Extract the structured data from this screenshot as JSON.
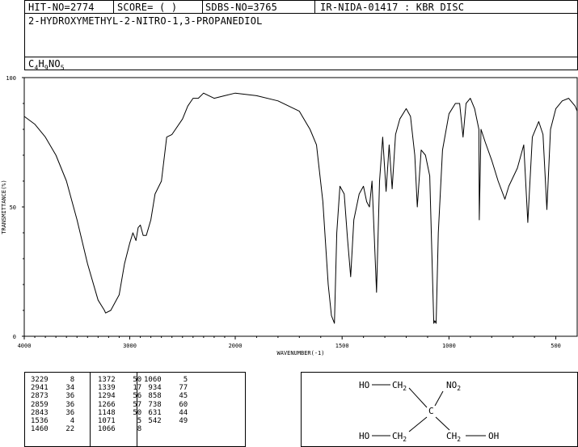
{
  "header": {
    "hit": "HIT-NO=2774",
    "score": "SCORE=  (  )",
    "sdbs": "SDBS-NO=3765",
    "ir": "IR-NIDA-01417 : KBR DISC"
  },
  "compound_name": "2-HYDROXYMETHYL-2-NITRO-1,3-PROPANEDIOL",
  "formula": {
    "c": "C",
    "c_n": "4",
    "h": "H",
    "h_n": "9",
    "rest": "NO",
    "o_n": "5"
  },
  "chart_data": {
    "type": "line",
    "xlabel": "WAVENUMBER(-1)",
    "ylabel": "TRANSMITTANCE(%)",
    "xlim": [
      4000,
      400
    ],
    "ylim": [
      0,
      100
    ],
    "x_ticks": [
      4000,
      3000,
      2000,
      1500,
      1000,
      500
    ],
    "x_tick_labels": [
      "4000",
      "3000",
      "2000",
      "1500",
      "1000",
      "500"
    ],
    "y_ticks": [
      0,
      50,
      100
    ],
    "y_tick_labels": [
      "0",
      "50",
      "100"
    ],
    "series": [
      {
        "points": [
          [
            4000,
            85
          ],
          [
            3900,
            82
          ],
          [
            3800,
            77
          ],
          [
            3700,
            70
          ],
          [
            3600,
            60
          ],
          [
            3500,
            45
          ],
          [
            3400,
            28
          ],
          [
            3300,
            14
          ],
          [
            3240,
            10
          ],
          [
            3229,
            9
          ],
          [
            3180,
            10
          ],
          [
            3100,
            16
          ],
          [
            3050,
            28
          ],
          [
            3000,
            36
          ],
          [
            2970,
            40
          ],
          [
            2941,
            37
          ],
          [
            2920,
            42
          ],
          [
            2900,
            43
          ],
          [
            2873,
            39
          ],
          [
            2859,
            39
          ],
          [
            2843,
            39
          ],
          [
            2800,
            45
          ],
          [
            2760,
            55
          ],
          [
            2700,
            60
          ],
          [
            2650,
            77
          ],
          [
            2600,
            78
          ],
          [
            2500,
            84
          ],
          [
            2450,
            89
          ],
          [
            2400,
            92
          ],
          [
            2350,
            92
          ],
          [
            2300,
            94
          ],
          [
            2200,
            92
          ],
          [
            2100,
            93
          ],
          [
            2000,
            94
          ],
          [
            1900,
            93
          ],
          [
            1800,
            91
          ],
          [
            1700,
            87
          ],
          [
            1650,
            80
          ],
          [
            1620,
            74
          ],
          [
            1590,
            52
          ],
          [
            1565,
            20
          ],
          [
            1550,
            8
          ],
          [
            1536,
            5
          ],
          [
            1525,
            40
          ],
          [
            1510,
            58
          ],
          [
            1490,
            55
          ],
          [
            1475,
            38
          ],
          [
            1460,
            23
          ],
          [
            1445,
            45
          ],
          [
            1420,
            55
          ],
          [
            1400,
            58
          ],
          [
            1385,
            52
          ],
          [
            1372,
            50
          ],
          [
            1360,
            60
          ],
          [
            1350,
            40
          ],
          [
            1339,
            17
          ],
          [
            1325,
            60
          ],
          [
            1310,
            77
          ],
          [
            1294,
            56
          ],
          [
            1280,
            74
          ],
          [
            1266,
            57
          ],
          [
            1250,
            78
          ],
          [
            1230,
            84
          ],
          [
            1200,
            88
          ],
          [
            1180,
            85
          ],
          [
            1160,
            70
          ],
          [
            1148,
            50
          ],
          [
            1130,
            72
          ],
          [
            1110,
            70
          ],
          [
            1090,
            62
          ],
          [
            1071,
            5
          ],
          [
            1066,
            6
          ],
          [
            1060,
            5
          ],
          [
            1050,
            40
          ],
          [
            1030,
            72
          ],
          [
            1000,
            86
          ],
          [
            970,
            90
          ],
          [
            950,
            90
          ],
          [
            934,
            77
          ],
          [
            920,
            90
          ],
          [
            900,
            92
          ],
          [
            880,
            88
          ],
          [
            860,
            80
          ],
          [
            858,
            45
          ],
          [
            850,
            80
          ],
          [
            830,
            75
          ],
          [
            800,
            68
          ],
          [
            770,
            60
          ],
          [
            738,
            53
          ],
          [
            720,
            58
          ],
          [
            680,
            65
          ],
          [
            650,
            74
          ],
          [
            631,
            44
          ],
          [
            610,
            77
          ],
          [
            580,
            83
          ],
          [
            560,
            78
          ],
          [
            542,
            49
          ],
          [
            525,
            80
          ],
          [
            500,
            88
          ],
          [
            470,
            91
          ],
          [
            440,
            92
          ],
          [
            410,
            89
          ],
          [
            400,
            87
          ]
        ]
      }
    ]
  },
  "peaks": {
    "col1": [
      [
        "3229",
        "8"
      ],
      [
        "2941",
        "34"
      ],
      [
        "2873",
        "36"
      ],
      [
        "2859",
        "36"
      ],
      [
        "2843",
        "36"
      ],
      [
        "1536",
        "4"
      ],
      [
        "1460",
        "22"
      ]
    ],
    "col2": [
      [
        "1372",
        "50"
      ],
      [
        "1339",
        "17"
      ],
      [
        "1294",
        "56"
      ],
      [
        "1266",
        "57"
      ],
      [
        "1148",
        "50"
      ],
      [
        "1071",
        "5"
      ],
      [
        "1066",
        "8"
      ]
    ],
    "col3": [
      [
        "1060",
        "5"
      ],
      [
        "934",
        "77"
      ],
      [
        "858",
        "45"
      ],
      [
        "738",
        "60"
      ],
      [
        "631",
        "44"
      ],
      [
        "542",
        "49"
      ]
    ]
  },
  "structure": {
    "ho_top": "HO",
    "ch2_top": "CH",
    "sub2": "2",
    "no2": "NO",
    "c_center": "C",
    "ho_bottom": "HO",
    "ch2_bottom_left": "CH",
    "ch2_bottom_right": "CH",
    "oh_right": "OH"
  }
}
